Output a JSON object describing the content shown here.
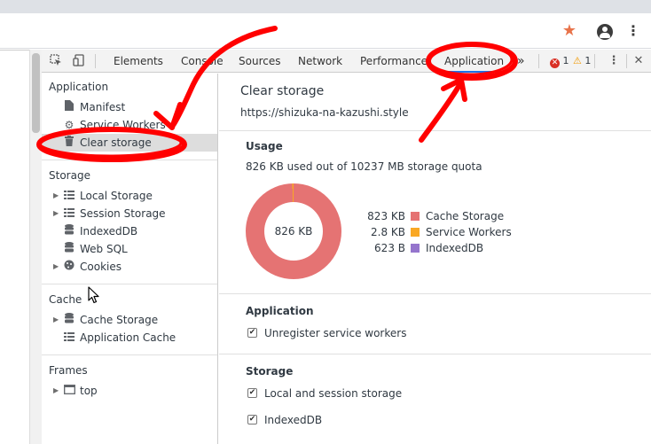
{
  "browser": {
    "star_icon": "star-icon",
    "account_icon": "account-icon",
    "menu_glyph": "⋮"
  },
  "devtools": {
    "tabs": [
      {
        "label": "Elements"
      },
      {
        "label": "Console"
      },
      {
        "label": "Sources"
      },
      {
        "label": "Network"
      },
      {
        "label": "Performance"
      },
      {
        "label": "Application"
      }
    ],
    "more_tabs": "»",
    "errors": "1",
    "warnings": "1",
    "kebab": "⋮",
    "close": "✕"
  },
  "sidebar": {
    "application_title": "Application",
    "application_items": [
      {
        "label": "Manifest",
        "icon": "document-icon"
      },
      {
        "label": "Service Workers",
        "icon": "gear-icon"
      },
      {
        "label": "Clear storage",
        "icon": "trash-icon"
      }
    ],
    "storage_title": "Storage",
    "storage_items": [
      {
        "label": "Local Storage",
        "icon": "grid-icon"
      },
      {
        "label": "Session Storage",
        "icon": "grid-icon"
      },
      {
        "label": "IndexedDB",
        "icon": "database-icon"
      },
      {
        "label": "Web SQL",
        "icon": "database-icon"
      },
      {
        "label": "Cookies",
        "icon": "cookie-icon"
      }
    ],
    "cache_title": "Cache",
    "cache_items": [
      {
        "label": "Cache Storage",
        "icon": "database-icon"
      },
      {
        "label": "Application Cache",
        "icon": "grid-icon"
      }
    ],
    "frames_title": "Frames",
    "frames_items": [
      {
        "label": "top",
        "icon": "window-icon"
      }
    ]
  },
  "main": {
    "title": "Clear storage",
    "url": "https://shizuka-na-kazushi.style",
    "usage_heading": "Usage",
    "usage_text": "826 KB used out of 10237 MB storage quota",
    "donut_label": "826 KB",
    "application_heading": "Application",
    "application_checks": [
      {
        "label": "Unregister service workers",
        "checked": true
      }
    ],
    "storage_heading": "Storage",
    "storage_checks": [
      {
        "label": "Local and session storage",
        "checked": true
      },
      {
        "label": "IndexedDB",
        "checked": true
      }
    ]
  },
  "chart_data": {
    "type": "pie",
    "title": "",
    "center_label": "826 KB",
    "series": [
      {
        "name": "Cache Storage",
        "value_label": "823 KB",
        "value_kb": 823,
        "color": "#e57373"
      },
      {
        "name": "Service Workers",
        "value_label": "2.8 KB",
        "value_kb": 2.8,
        "color": "#f9a825"
      },
      {
        "name": "IndexedDB",
        "value_label": "623 B",
        "value_kb": 0.608,
        "color": "#9575cd"
      }
    ]
  },
  "colors": {
    "accent": "#1a73e8",
    "annotation": "#ff0000",
    "selected_bg": "#dddddd"
  }
}
